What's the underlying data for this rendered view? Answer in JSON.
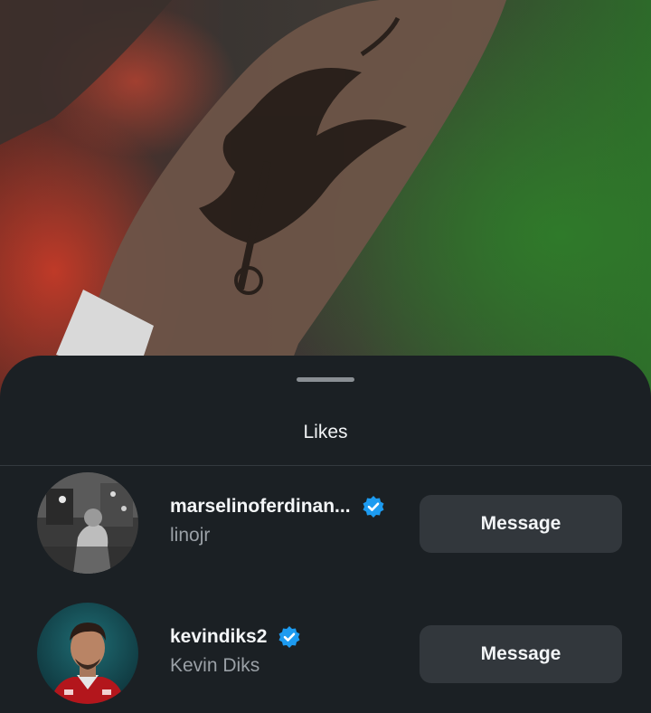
{
  "sheet": {
    "title": "Likes"
  },
  "likes": [
    {
      "username": "marselinoferdinan...",
      "full_name": "linojr",
      "verified": true,
      "action_label": "Message"
    },
    {
      "username": "kevindiks2",
      "full_name": "Kevin Diks",
      "verified": true,
      "action_label": "Message"
    }
  ],
  "colors": {
    "sheet_background": "#1b2024",
    "verified_badge": "#1d9bf0",
    "button_background": "#32373c",
    "secondary_text": "#9aa0a6"
  },
  "icons": {
    "verified": "verified-badge-icon",
    "drag": "drag-handle"
  }
}
